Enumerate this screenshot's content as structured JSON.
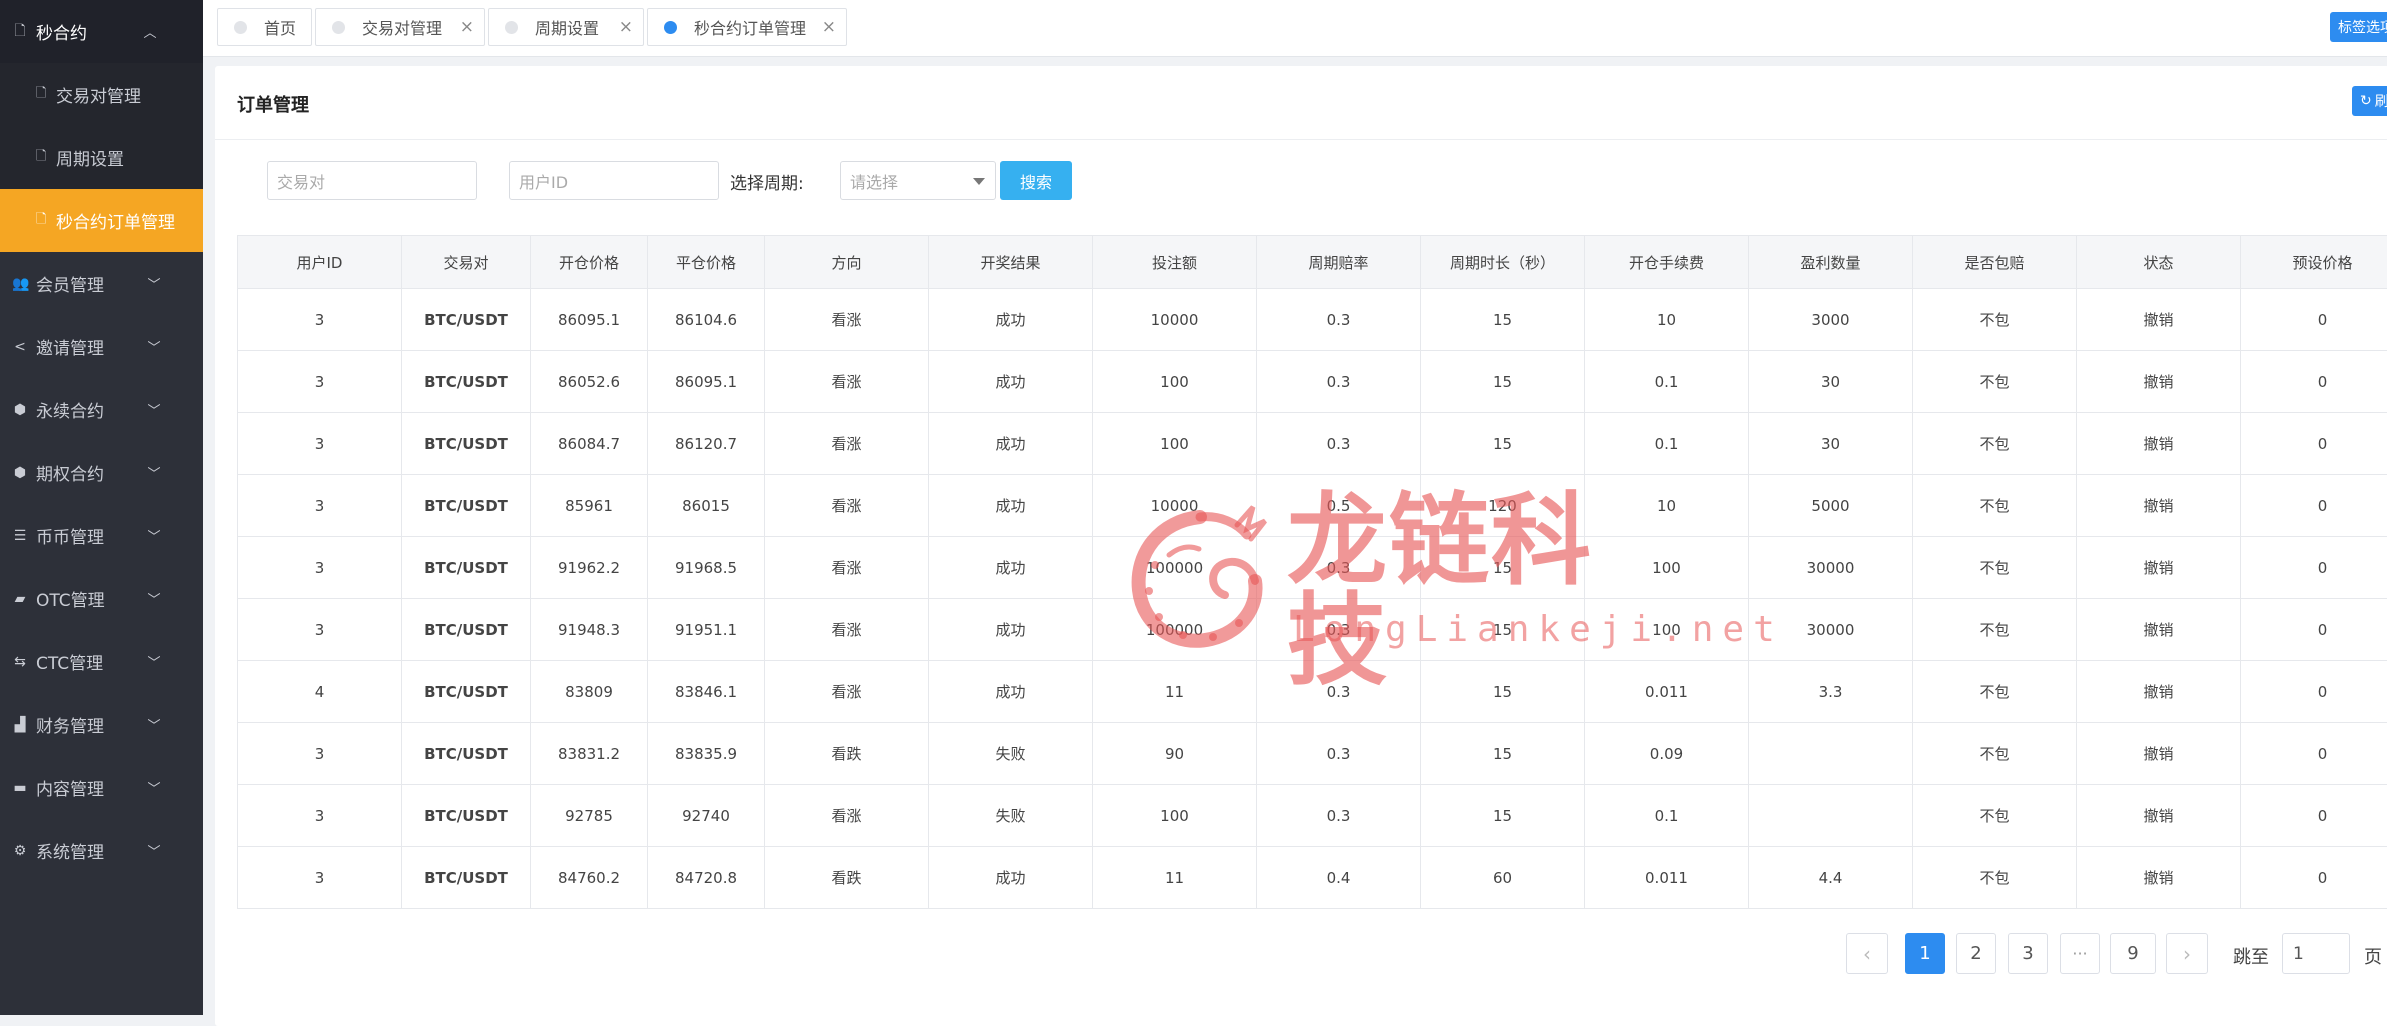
{
  "sidebar": {
    "top": {
      "label": "秒合约",
      "icon": "file-icon"
    },
    "sub_items": [
      {
        "label": "交易对管理",
        "icon": "file-icon"
      },
      {
        "label": "周期设置",
        "icon": "file-icon"
      },
      {
        "label": "秒合约订单管理",
        "icon": "file-icon",
        "active": true
      }
    ],
    "groups": [
      {
        "label": "会员管理",
        "icon": "users-icon"
      },
      {
        "label": "邀请管理",
        "icon": "share-icon"
      },
      {
        "label": "永续合约",
        "icon": "cube-icon"
      },
      {
        "label": "期权合约",
        "icon": "cube-icon"
      },
      {
        "label": "币币管理",
        "icon": "sliders-icon"
      },
      {
        "label": "OTC管理",
        "icon": "briefcase-icon"
      },
      {
        "label": "CTC管理",
        "icon": "exchange-icon"
      },
      {
        "label": "财务管理",
        "icon": "bar-chart-icon"
      },
      {
        "label": "内容管理",
        "icon": "folder-icon"
      },
      {
        "label": "系统管理",
        "icon": "gear-icon"
      }
    ]
  },
  "tabs": [
    {
      "label": "首页",
      "closable": false
    },
    {
      "label": "交易对管理",
      "closable": true
    },
    {
      "label": "周期设置",
      "closable": true
    },
    {
      "label": "秒合约订单管理",
      "closable": true,
      "current": true
    }
  ],
  "tab_options_label": "标签选项",
  "panel": {
    "title": "订单管理",
    "refresh_label": "刷新"
  },
  "filters": {
    "pair_placeholder": "交易对",
    "user_placeholder": "用户ID",
    "period_label": "选择周期:",
    "period_placeholder": "请选择",
    "search_label": "搜索"
  },
  "table": {
    "headers": [
      "用户ID",
      "交易对",
      "开仓价格",
      "平仓价格",
      "方向",
      "开奖结果",
      "投注额",
      "周期赔率",
      "周期时长（秒）",
      "开仓手续费",
      "盈利数量",
      "是否包赔",
      "状态",
      "预设价格"
    ],
    "rows": [
      [
        "3",
        "BTC/USDT",
        "86095.1",
        "86104.6",
        "看涨",
        "成功",
        "10000",
        "0.3",
        "15",
        "10",
        "3000",
        "不包",
        "撤销",
        "0"
      ],
      [
        "3",
        "BTC/USDT",
        "86052.6",
        "86095.1",
        "看涨",
        "成功",
        "100",
        "0.3",
        "15",
        "0.1",
        "30",
        "不包",
        "撤销",
        "0"
      ],
      [
        "3",
        "BTC/USDT",
        "86084.7",
        "86120.7",
        "看涨",
        "成功",
        "100",
        "0.3",
        "15",
        "0.1",
        "30",
        "不包",
        "撤销",
        "0"
      ],
      [
        "3",
        "BTC/USDT",
        "85961",
        "86015",
        "看涨",
        "成功",
        "10000",
        "0.5",
        "120",
        "10",
        "5000",
        "不包",
        "撤销",
        "0"
      ],
      [
        "3",
        "BTC/USDT",
        "91962.2",
        "91968.5",
        "看涨",
        "成功",
        "100000",
        "0.3",
        "15",
        "100",
        "30000",
        "不包",
        "撤销",
        "0"
      ],
      [
        "3",
        "BTC/USDT",
        "91948.3",
        "91951.1",
        "看涨",
        "成功",
        "100000",
        "0.3",
        "15",
        "100",
        "30000",
        "不包",
        "撤销",
        "0"
      ],
      [
        "4",
        "BTC/USDT",
        "83809",
        "83846.1",
        "看涨",
        "成功",
        "11",
        "0.3",
        "15",
        "0.011",
        "3.3",
        "不包",
        "撤销",
        "0"
      ],
      [
        "3",
        "BTC/USDT",
        "83831.2",
        "83835.9",
        "看跌",
        "失败",
        "90",
        "0.3",
        "15",
        "0.09",
        "",
        "不包",
        "撤销",
        "0"
      ],
      [
        "3",
        "BTC/USDT",
        "92785",
        "92740",
        "看涨",
        "失败",
        "100",
        "0.3",
        "15",
        "0.1",
        "",
        "不包",
        "撤销",
        "0"
      ],
      [
        "3",
        "BTC/USDT",
        "84760.2",
        "84720.8",
        "看跌",
        "成功",
        "11",
        "0.4",
        "60",
        "0.011",
        "4.4",
        "不包",
        "撤销",
        "0"
      ]
    ]
  },
  "pagination": {
    "prev": "‹",
    "pages": [
      "1",
      "2",
      "3",
      "···",
      "9"
    ],
    "current": "1",
    "next": "›",
    "goto_label": "跳至",
    "goto_value": "1",
    "page_unit": "页"
  },
  "watermark": {
    "cn": "龙链科技",
    "en": "LongLiankeji.net"
  },
  "colors": {
    "sidebar_bg": "#2d3039",
    "active_item": "#f5a623",
    "primary": "#2d8cf0",
    "search_btn": "#36b0f0",
    "rise_green": "#4cae6c",
    "fall_red": "#e02424",
    "watermark": "#e75656"
  }
}
